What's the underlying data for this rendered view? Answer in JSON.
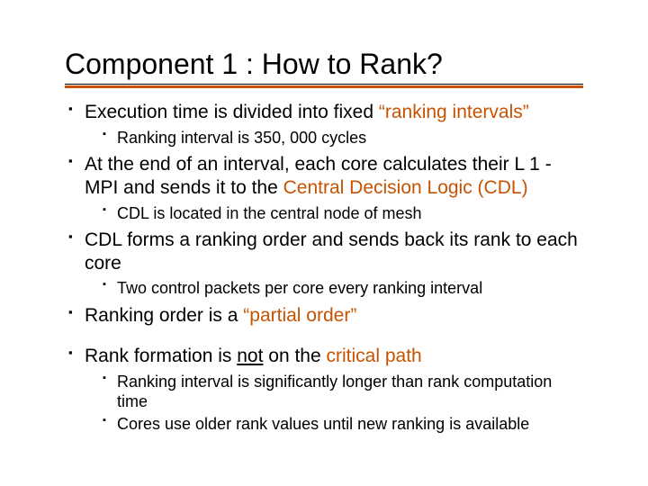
{
  "title": "Component 1 : How to Rank?",
  "b1": {
    "pre": "Execution time is divided into fixed ",
    "accent": "“ranking intervals”",
    "sub1": "Ranking interval is 350, 000 cycles"
  },
  "b2": {
    "pre": "At the end of an interval, each core calculates their L 1 -MPI and  sends it to the ",
    "accent": "Central Decision Logic (CDL)",
    "sub1": "CDL is located in the central node of mesh"
  },
  "b3": {
    "text": "CDL forms a ranking order and sends back its rank to each core",
    "sub1": "Two control packets per core every ranking interval"
  },
  "b4": {
    "pre": "Ranking order is a ",
    "accent": "“partial order”"
  },
  "b5": {
    "pre": "Rank formation is ",
    "mid": "not",
    "post": " on the ",
    "accent": "critical path",
    "sub1": "Ranking interval is significantly longer than rank computation time",
    "sub2": "Cores use older rank values until new ranking is available"
  }
}
